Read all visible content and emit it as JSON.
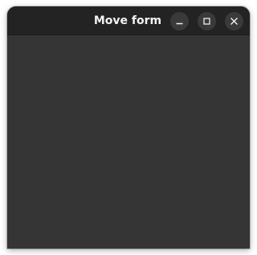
{
  "window": {
    "title": "Move form",
    "controls": {
      "minimize": "minimize-icon",
      "maximize": "maximize-icon",
      "close": "close-icon"
    }
  },
  "colors": {
    "titlebar": "#232323",
    "content_background": "#353535",
    "title_text": "#f2f2f2",
    "control_button": "#3a3a3a"
  }
}
